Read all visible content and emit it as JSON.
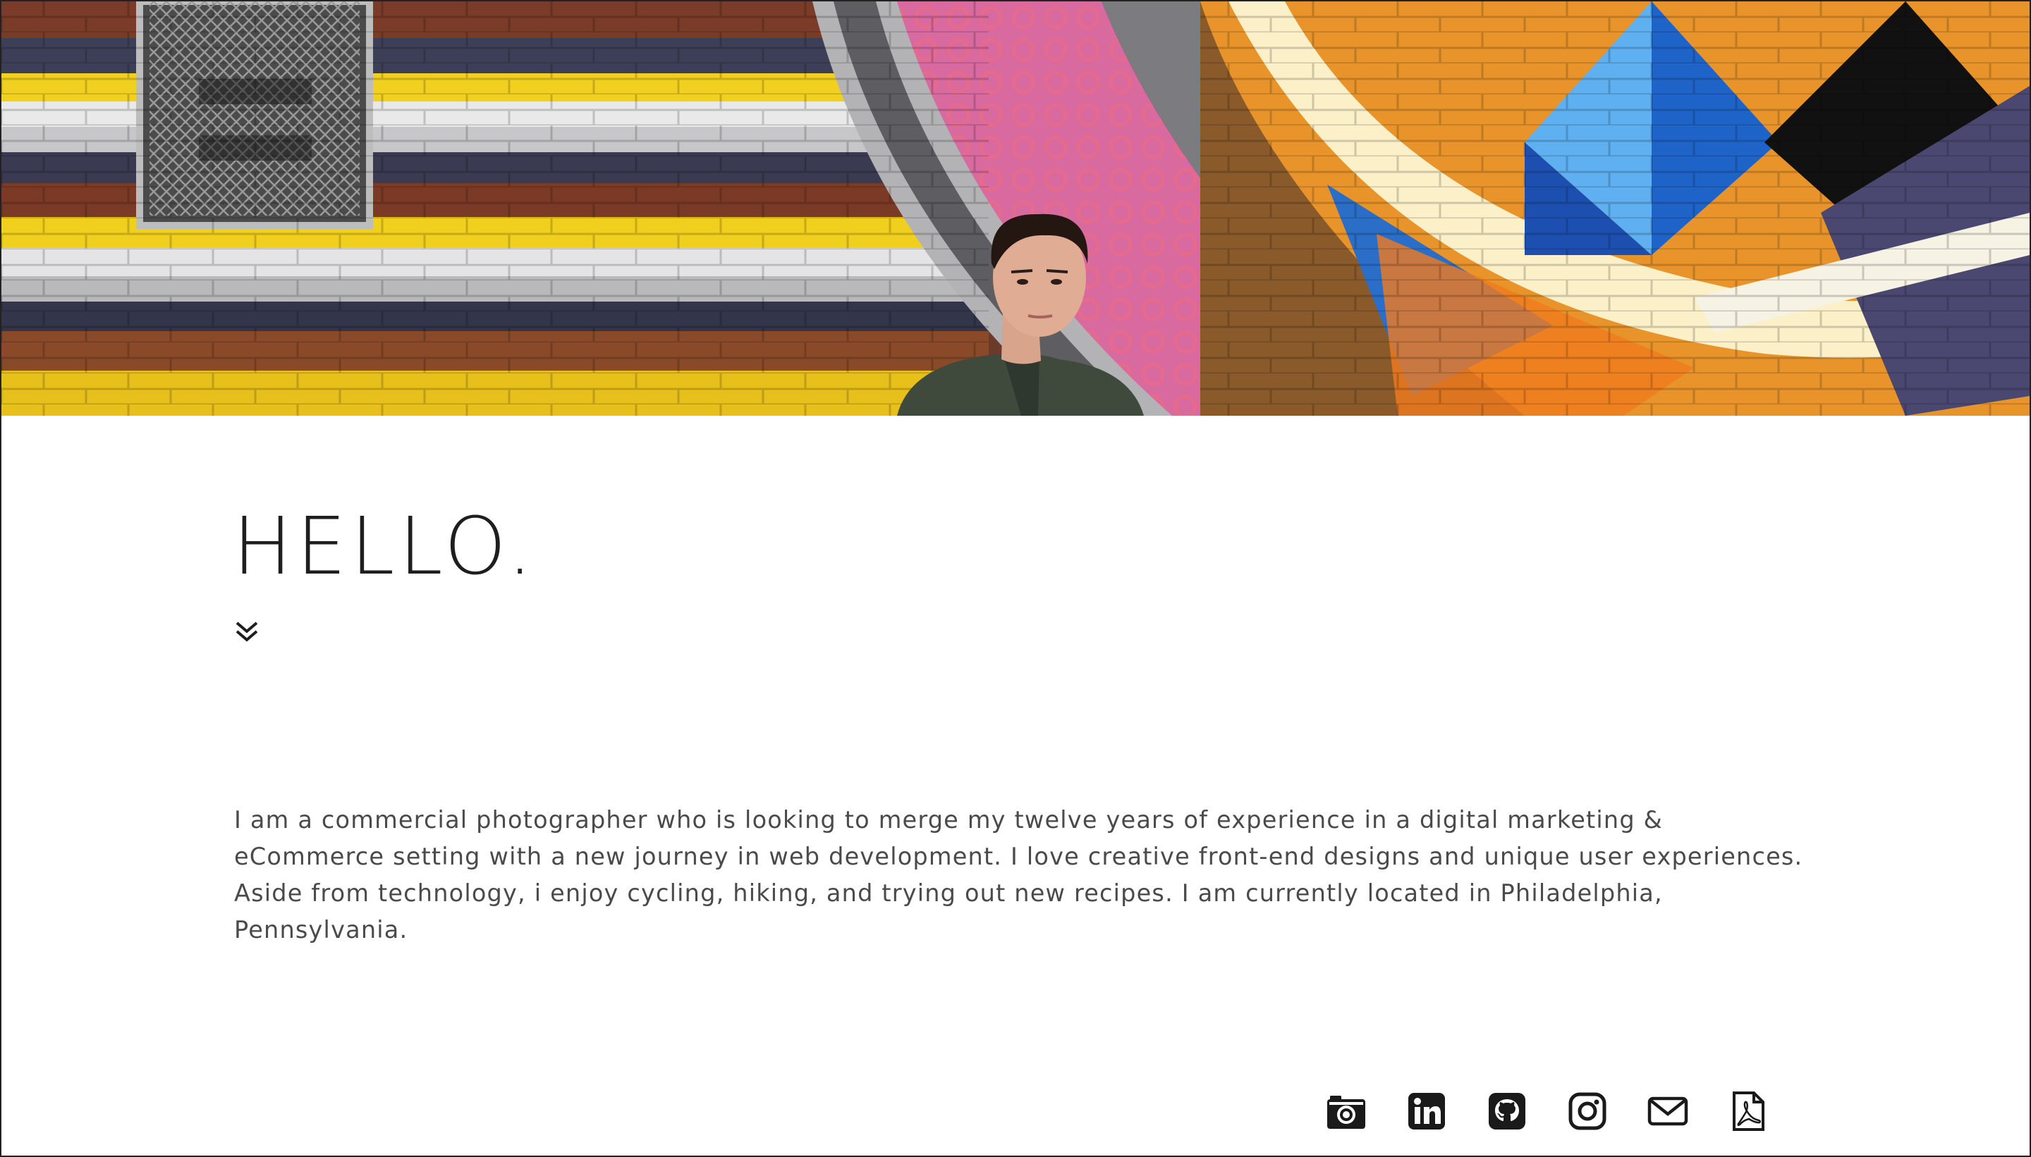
{
  "hero": {
    "alt": "Portrait in front of a colorful striped brick mural"
  },
  "intro": {
    "heading": "HELLO.",
    "bio": "I am a commercial photographer who is looking to merge my twelve years of experience in a digital marketing & eCommerce setting with a new journey in web development. I love creative front-end designs and unique user experiences. Aside from technology, i enjoy cycling, hiking, and trying out new recipes. I am currently located in Philadelphia, Pennsylvania."
  },
  "social_links": [
    {
      "icon": "camera-icon"
    },
    {
      "icon": "linkedin-icon"
    },
    {
      "icon": "github-icon"
    },
    {
      "icon": "instagram-icon"
    },
    {
      "icon": "email-icon"
    },
    {
      "icon": "pdf-resume-icon"
    }
  ],
  "colors": {
    "text_dark": "#1e1e1e",
    "text_body": "#4a4a4a",
    "background": "#ffffff",
    "icon": "#1a1a1a"
  }
}
